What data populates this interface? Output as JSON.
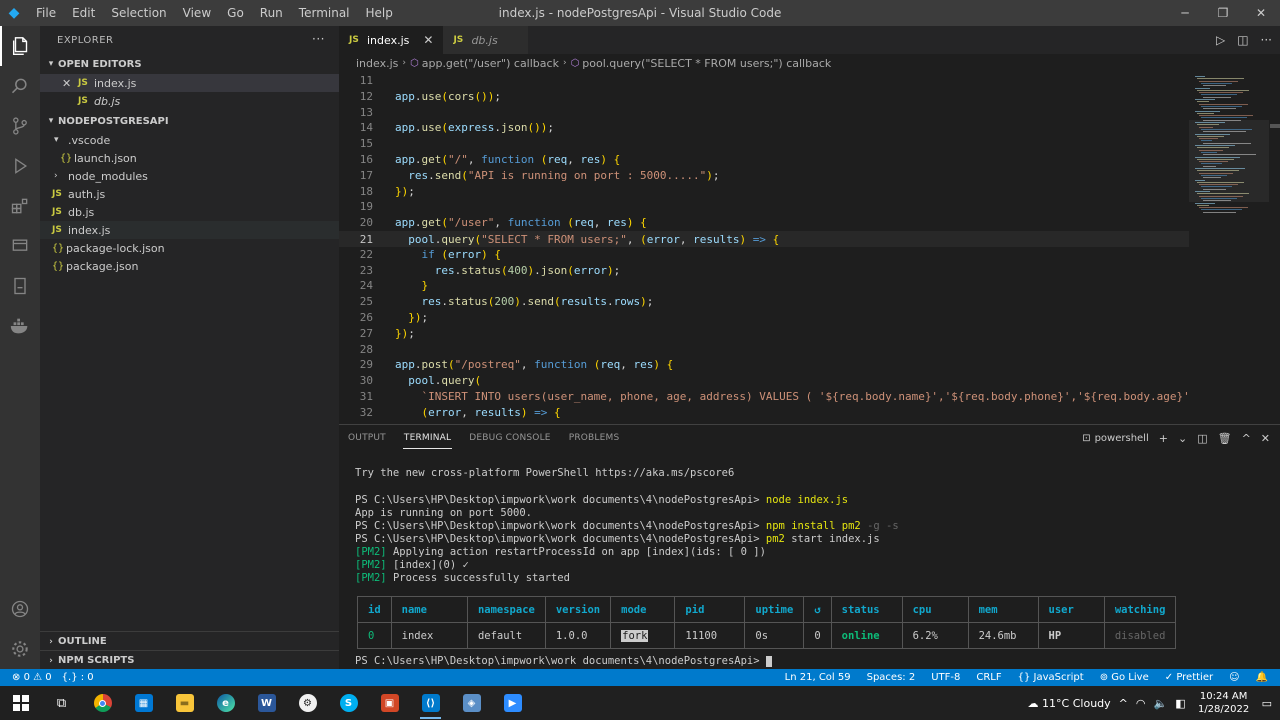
{
  "titlebar": {
    "logo": "vscode-logo",
    "menu": [
      "File",
      "Edit",
      "Selection",
      "View",
      "Go",
      "Run",
      "Terminal",
      "Help"
    ],
    "title": "index.js - nodePostgresApi - Visual Studio Code"
  },
  "sidebar": {
    "header": "EXPLORER",
    "open_editors_title": "OPEN EDITORS",
    "open_editors": [
      {
        "name": "index.js",
        "icon": "JS"
      },
      {
        "name": "db.js",
        "icon": "JS"
      }
    ],
    "project_title": "NODEPOSTGRESAPI",
    "tree": [
      {
        "name": ".vscode"
      },
      {
        "name": "launch.json"
      },
      {
        "name": "node_modules"
      },
      {
        "name": "auth.js"
      },
      {
        "name": "db.js"
      },
      {
        "name": "index.js"
      },
      {
        "name": "package-lock.json"
      },
      {
        "name": "package.json"
      }
    ],
    "outline_title": "OUTLINE",
    "npm_title": "NPM SCRIPTS"
  },
  "tabs": [
    {
      "label": "index.js",
      "icon": "JS",
      "active": true
    },
    {
      "label": "db.js",
      "icon": "JS",
      "active": false
    }
  ],
  "breadcrumb": [
    "index.js",
    "app.get(\"/user\") callback",
    "pool.query(\"SELECT * FROM users;\") callback"
  ],
  "code_lines": [
    {
      "n": "11",
      "text": ""
    },
    {
      "n": "12",
      "text": "app.use(cors());"
    },
    {
      "n": "13",
      "text": ""
    },
    {
      "n": "14",
      "text": "app.use(express.json());"
    },
    {
      "n": "15",
      "text": ""
    },
    {
      "n": "16",
      "text": "app.get(\"/\", function (req, res) {"
    },
    {
      "n": "17",
      "text": "  res.send(\"API is running on port : 5000.....\");"
    },
    {
      "n": "18",
      "text": "});"
    },
    {
      "n": "19",
      "text": ""
    },
    {
      "n": "20",
      "text": "app.get(\"/user\", function (req, res) {"
    },
    {
      "n": "21",
      "text": "  pool.query(\"SELECT * FROM users;\", (error, results) => {"
    },
    {
      "n": "22",
      "text": "    if (error) {"
    },
    {
      "n": "23",
      "text": "      res.status(400).json(error);"
    },
    {
      "n": "24",
      "text": "    }"
    },
    {
      "n": "25",
      "text": "    res.status(200).send(results.rows);"
    },
    {
      "n": "26",
      "text": "  });"
    },
    {
      "n": "27",
      "text": "});"
    },
    {
      "n": "28",
      "text": ""
    },
    {
      "n": "29",
      "text": "app.post(\"/postreq\", function (req, res) {"
    },
    {
      "n": "30",
      "text": "  pool.query("
    },
    {
      "n": "31",
      "text": "    `INSERT INTO users(user_name, phone, age, address) VALUES ( '${req.body.name}','${req.body.phone}','${req.body.age}','${"
    },
    {
      "n": "32",
      "text": "    (error, results) => {"
    }
  ],
  "panel": {
    "tabs": [
      "OUTPUT",
      "TERMINAL",
      "DEBUG CONSOLE",
      "PROBLEMS"
    ],
    "shell": "powershell",
    "terminal": {
      "l1": "Try the new cross-platform PowerShell https://aka.ms/pscore6",
      "prompt": "PS C:\\Users\\HP\\Desktop\\impwork\\work documents\\4\\nodePostgresApi>",
      "cmd1": "node index.js",
      "out1": "App is running on port 5000.",
      "cmd2_a": "npm install pm2",
      "cmd2_b": "-g -s",
      "cmd3_a": "pm2",
      "cmd3_b": "start index.js",
      "pm2_tag": "[PM2]",
      "pm2_1": "Applying action restartProcessId on app [index](ids: [ 0 ])",
      "pm2_2": "[index](0) ✓",
      "pm2_3": "Process successfully started"
    },
    "pm2_headers": [
      "id",
      "name",
      "namespace",
      "version",
      "mode",
      "pid",
      "uptime",
      "↺",
      "status",
      "cpu",
      "mem",
      "user",
      "watching"
    ],
    "pm2_row": [
      "0",
      "index",
      "default",
      "1.0.0",
      "fork",
      "11100",
      "0s",
      "0",
      "online",
      "6.2%",
      "24.6mb",
      "HP",
      "disabled"
    ]
  },
  "statusbar": {
    "errors": "0",
    "warnings": "0",
    "braces": "{.} : 0",
    "position": "Ln 21, Col 59",
    "spaces": "Spaces: 2",
    "encoding": "UTF-8",
    "eol": "CRLF",
    "language": "JavaScript",
    "golive": "Go Live",
    "prettier": "Prettier"
  },
  "taskbar": {
    "weather": "11°C  Cloudy",
    "time": "10:24 AM",
    "date": "1/28/2022"
  },
  "colors": {
    "accent": "#007acc",
    "terminal_green": "#0dbc79",
    "pm2_cyan": "#11a8cd"
  }
}
